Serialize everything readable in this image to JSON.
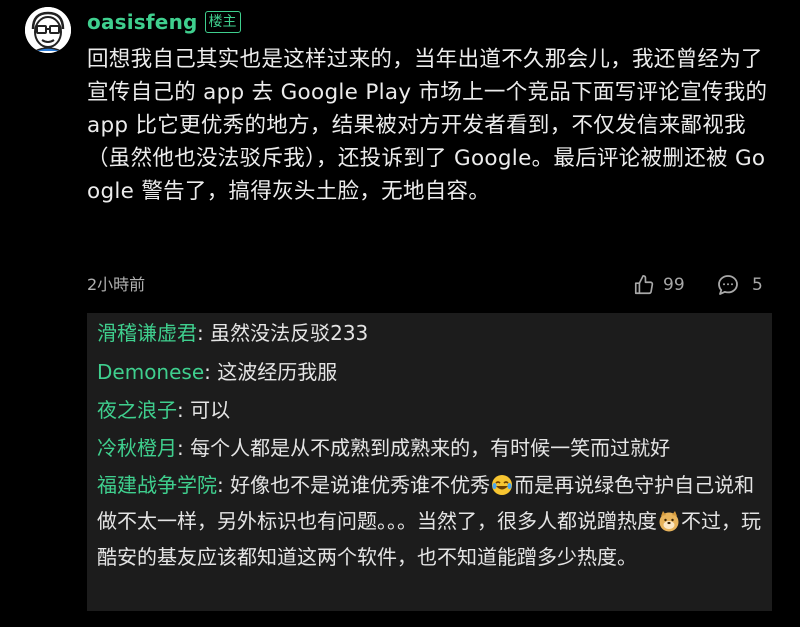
{
  "post": {
    "author": "oasisfeng",
    "badge": "楼主",
    "body": "回想我自己其实也是这样过来的，当年出道不久那会儿，我还曾经为了宣传自己的 app 去 Google Play 市场上一个竞品下面写评论宣传我的 app 比它更优秀的地方，结果被对方开发者看到，不仅发信来鄙视我（虽然他也没法驳斥我），还投诉到了 Google。最后评论被删还被 Google 警告了，搞得灰头土脸，无地自容。",
    "time": "2小時前",
    "likes": "99",
    "comments": "5"
  },
  "icons": {
    "avatar": "avatar-cartoon",
    "like": "thumbs-up-icon",
    "comment": "speech-bubble-icon"
  },
  "colors": {
    "username": "#3fcf8e",
    "background": "#000000",
    "reply_background": "#1c1c1c",
    "text": "#ececec",
    "muted": "#a8a8a8"
  },
  "replies": [
    {
      "name": "滑稽谦虚君",
      "sep": ": ",
      "text": "虽然没法反驳233"
    },
    {
      "name": "Demonese",
      "sep": ": ",
      "text": "这波经历我服"
    },
    {
      "name": "夜之浪子",
      "sep": ": ",
      "text": "可以"
    },
    {
      "name": "冷秋橙月",
      "sep": ": ",
      "text": "每个人都是从不成熟到成熟来的，有时候一笑而过就好"
    },
    {
      "name": "福建战争学院",
      "sep": ": ",
      "text_a": "好像也不是说谁优秀谁不优秀",
      "text_b": "而是再说绿色守护自己说和做不太一样，另外标识也有问题。。。当然了，很多人都说蹭热度",
      "text_c": "不过，玩酷安的基友应该都知道这两个软件，也不知道能蹭多少热度。",
      "emoji_1": "laughing-crying-emoji",
      "emoji_2": "doge-emoji"
    }
  ]
}
